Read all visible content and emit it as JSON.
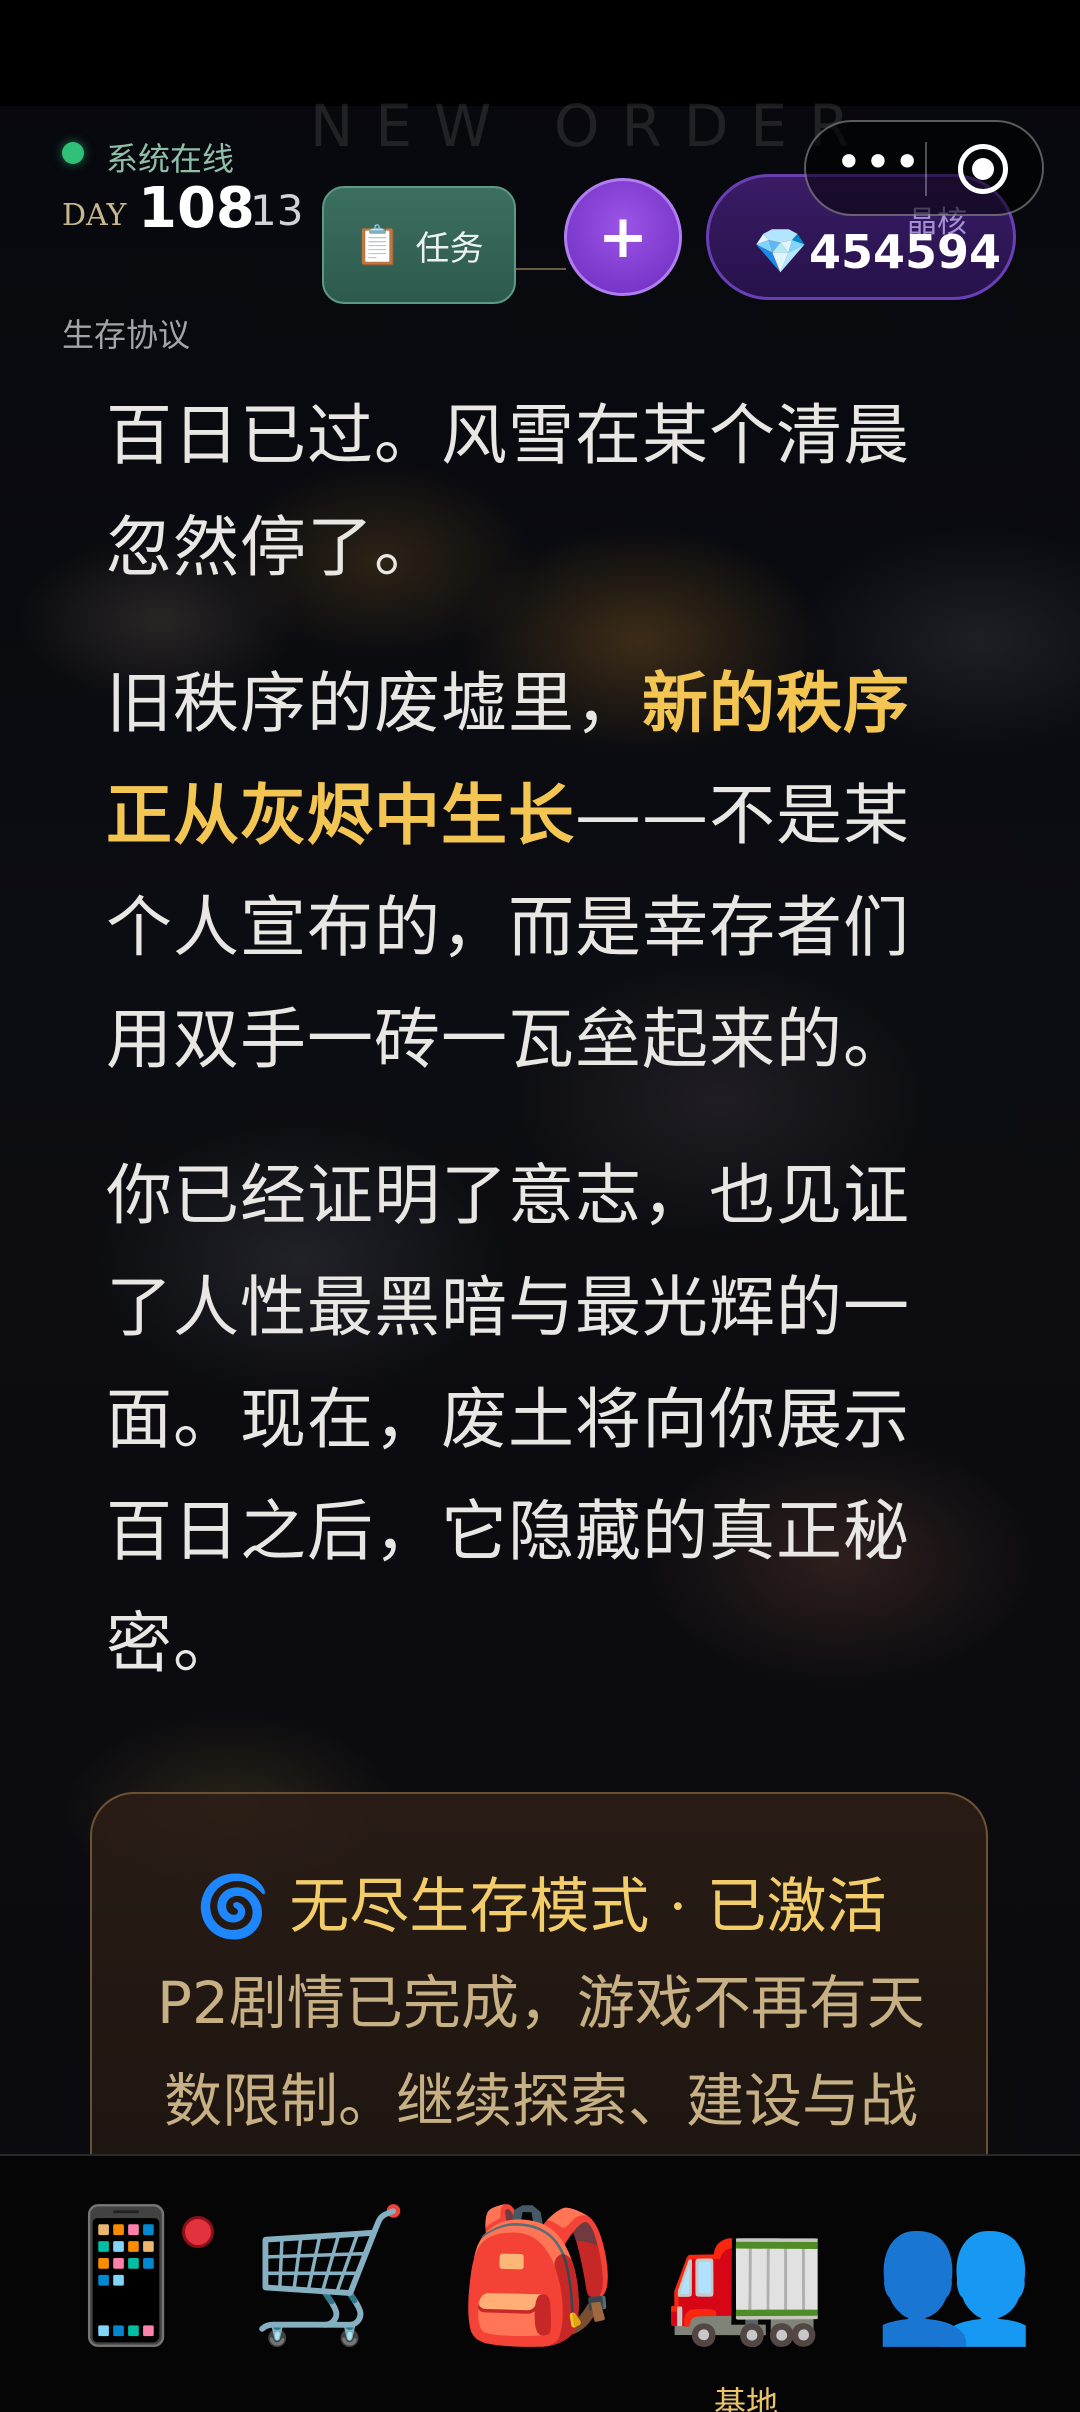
{
  "header": {
    "watermark": "NEW ORDER",
    "status_text": "系统在线",
    "day_label": "DAY",
    "day_number": "108",
    "day_sub": "13",
    "section_label": "生存协议",
    "task_button": {
      "icon": "📋",
      "label": "任务"
    },
    "plus_button": "+",
    "crystal": {
      "label": "晶核",
      "icon": "💎",
      "value": "454594"
    },
    "capsule": {
      "more": "•••"
    }
  },
  "story": {
    "p1": "百日已过。风雪在某个清晨忽然停了。",
    "p2_before": "旧秩序的废墟里，",
    "p2_highlight": "新的秩序正从灰烬中生长",
    "p2_after": "——不是某个人宣布的，而是幸存者们用双手一砖一瓦垒起来的。",
    "p3": "你已经证明了意志，也见证了人性最黑暗与最光辉的一面。现在，废土将向你展示百日之后，它隐藏的真正秘密。"
  },
  "endless_mode": {
    "title": "🌀 无尽生存模式 · 已激活",
    "description": "P2剧情已完成，游戏不再有天数限制。继续探索、建设与战"
  },
  "bottom_nav": {
    "items": [
      {
        "icon": "📱",
        "label": ""
      },
      {
        "icon": "🛒",
        "label": ""
      },
      {
        "icon": "🎒",
        "label": ""
      },
      {
        "icon": "🚛",
        "label": "基地"
      },
      {
        "icon": "👥",
        "label": ""
      }
    ]
  },
  "colors": {
    "accent_gold": "#f3c552",
    "online_green": "#2fbf76",
    "purple": "#6d2bbf",
    "task_green": "#3c6f60"
  }
}
